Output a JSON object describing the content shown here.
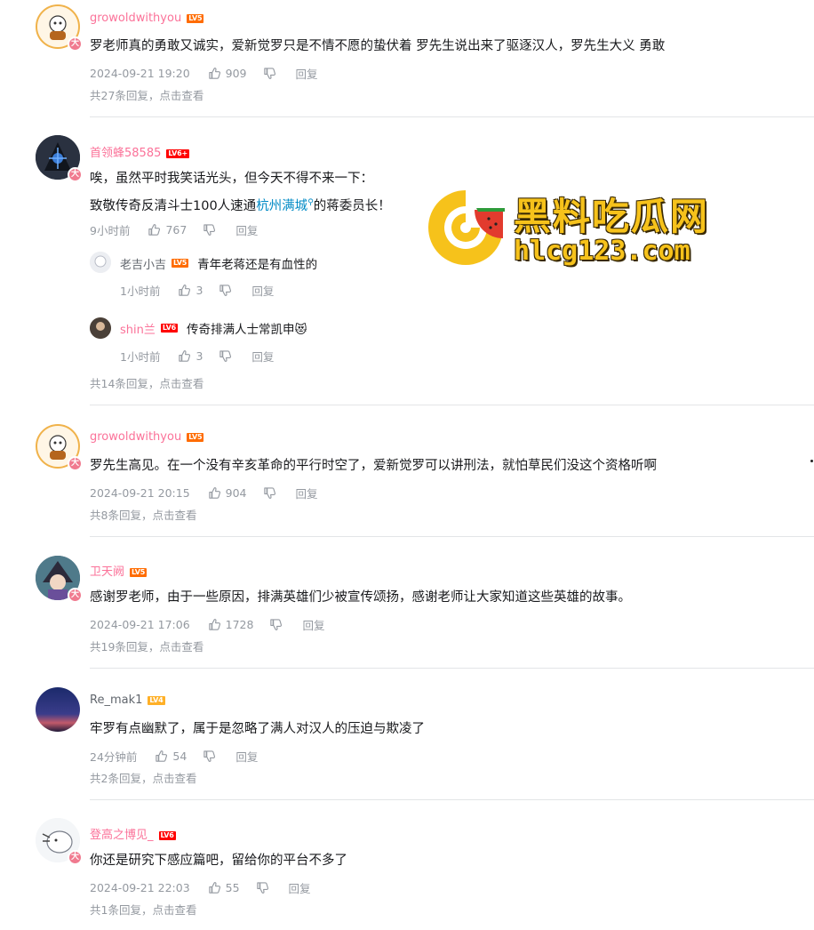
{
  "watermark": {
    "title": "黑料吃瓜网",
    "url": "hlcg123.com"
  },
  "icons": {
    "like": "thumbs-up-icon",
    "dislike": "thumbs-down-icon",
    "vip": "大"
  },
  "comments": [
    {
      "user": "growoldwithyou",
      "level": "LV5",
      "text": "罗老师真的勇敢又诚实，爱新觉罗只是不情不愿的蛰伏着 罗先生说出来了驱逐汉人，罗先生大义 勇敢",
      "time": "2024-09-21 19:20",
      "likes": "909",
      "reply_label": "回复",
      "more": "共27条回复，",
      "more_click": "点击查看"
    },
    {
      "user": "首领蜂58585",
      "level": "LV6+",
      "text_line1": "唉，虽然平时我笑话光头，但今天不得不来一下：",
      "text_line2_a": "致敬传奇反清斗士100人速通",
      "text_line2_link": "杭州满城",
      "text_line2_b": "的蒋委员长！",
      "time": "9小时前",
      "likes": "767",
      "reply_label": "回复",
      "replies": [
        {
          "user": "老吉小吉",
          "level": "LV5",
          "text": "青年老蒋还是有血性的",
          "time": "1小时前",
          "likes": "3",
          "reply_label": "回复"
        },
        {
          "user": "shin兰",
          "level": "LV6",
          "text": "传奇排满人士常凯申😻",
          "time": "1小时前",
          "likes": "3",
          "reply_label": "回复"
        }
      ],
      "more": "共14条回复，",
      "more_click": "点击查看"
    },
    {
      "user": "growoldwithyou",
      "level": "LV5",
      "text": "罗先生高见。在一个没有辛亥革命的平行时空了，爱新觉罗可以讲刑法，就怕草民们没这个资格听啊",
      "time": "2024-09-21 20:15",
      "likes": "904",
      "reply_label": "回复",
      "more": "共8条回复，",
      "more_click": "点击查看"
    },
    {
      "user": "卫天阙",
      "level": "LV5",
      "text": "感谢罗老师，由于一些原因，排满英雄们少被宣传颂扬，感谢老师让大家知道这些英雄的故事。",
      "time": "2024-09-21 17:06",
      "likes": "1728",
      "reply_label": "回复",
      "more": "共19条回复，",
      "more_click": "点击查看"
    },
    {
      "user": "Re_mak1",
      "level": "LV4",
      "text": "牢罗有点幽默了，属于是忽略了满人对汉人的压迫与欺凌了",
      "time": "24分钟前",
      "likes": "54",
      "reply_label": "回复",
      "more": "共2条回复，",
      "more_click": "点击查看"
    },
    {
      "user": "登高之博见_",
      "level": "LV6",
      "text": "你还是研究下感应篇吧，留给你的平台不多了",
      "time": "2024-09-21 22:03",
      "likes": "55",
      "reply_label": "回复",
      "more": "共1条回复，",
      "more_click": "点击查看"
    }
  ]
}
